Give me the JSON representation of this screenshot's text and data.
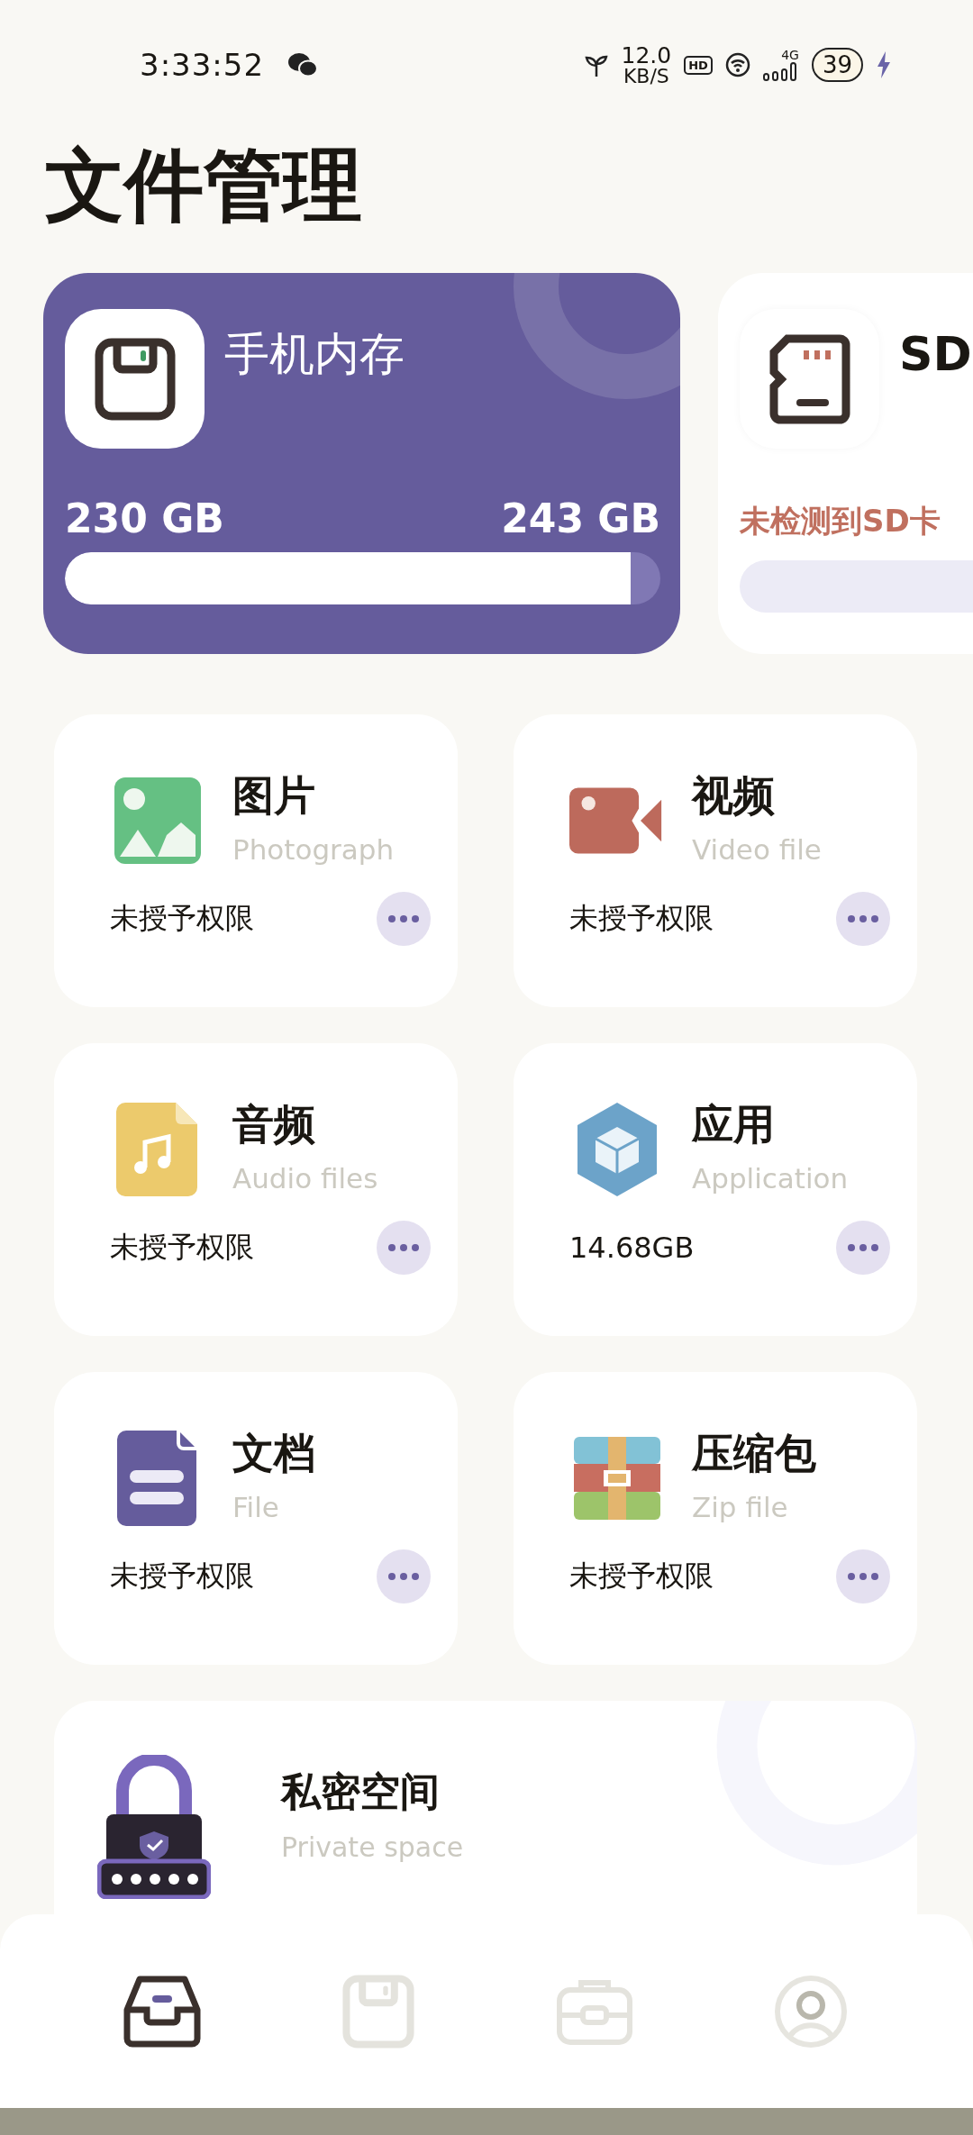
{
  "status_bar": {
    "time": "3:33:52",
    "net_speed": "12.0",
    "net_unit": "KB/S",
    "hd": "HD",
    "network": "4G",
    "battery": "39"
  },
  "title": "文件管理",
  "storage": [
    {
      "kind": "internal",
      "name": "手机内存",
      "used": "230 GB",
      "total": "243 GB",
      "level": 0.95
    },
    {
      "kind": "sd",
      "name": "SD",
      "status": "未检测到SD卡"
    }
  ],
  "categories": [
    {
      "kind": "image",
      "title": "图片",
      "subtitle": "Photograph",
      "status": "未授予权限"
    },
    {
      "kind": "video",
      "title": "视频",
      "subtitle": "Video file",
      "status": "未授予权限"
    },
    {
      "kind": "audio",
      "title": "音频",
      "subtitle": "Audio files",
      "status": "未授予权限"
    },
    {
      "kind": "app",
      "title": "应用",
      "subtitle": "Application",
      "status": "14.68GB"
    },
    {
      "kind": "document",
      "title": "文档",
      "subtitle": "File",
      "status": "未授予权限"
    },
    {
      "kind": "zip",
      "title": "压缩包",
      "subtitle": "Zip file",
      "status": "未授予权限"
    }
  ],
  "private_space": {
    "title": "私密空间",
    "subtitle": "Private space"
  },
  "nav": [
    {
      "kind": "files",
      "selected": true
    },
    {
      "kind": "storage",
      "selected": false
    },
    {
      "kind": "tools",
      "selected": false
    },
    {
      "kind": "profile",
      "selected": false
    }
  ]
}
